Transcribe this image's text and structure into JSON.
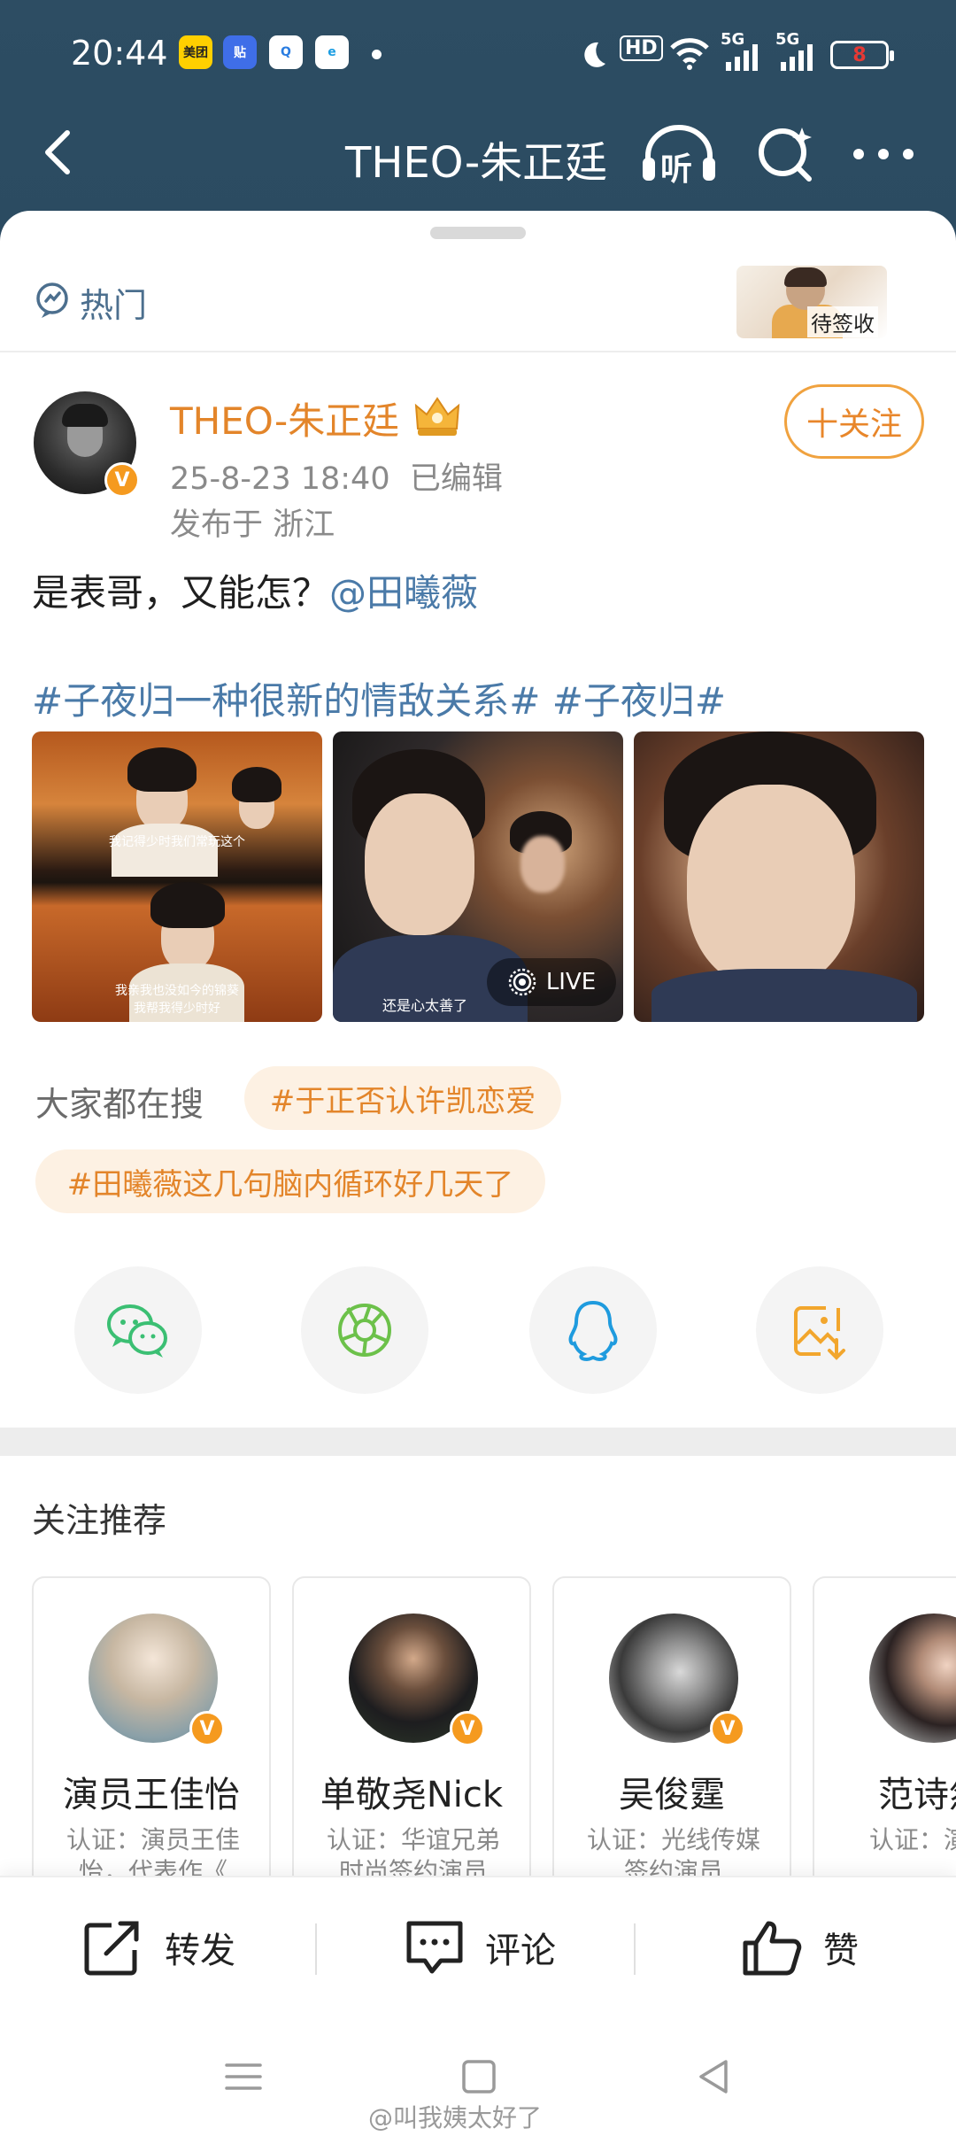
{
  "status_bar": {
    "time": "20:44",
    "app_icons": [
      {
        "name": "meituan-app-icon",
        "label": "美团",
        "bg": "#ffd000",
        "fg": "#222222"
      },
      {
        "name": "tieba-app-icon",
        "label": "贴",
        "bg": "#3f6ee8",
        "fg": "#ffffff"
      },
      {
        "name": "qq-browser-app-icon",
        "label": "Q",
        "bg": "#ffffff",
        "fg": "#2a7de1"
      },
      {
        "name": "edge-browser-app-icon",
        "label": "e",
        "bg": "#ffffff",
        "fg": "#1b9de2"
      }
    ],
    "hd_label": "HD",
    "signal_labels": [
      "5G",
      "5G"
    ],
    "battery": "8"
  },
  "nav": {
    "title": "THEO-朱正廷",
    "listen_label": "听"
  },
  "hot": {
    "label": "热门",
    "sticker_text": "待签收"
  },
  "post": {
    "username": "THEO-朱正廷",
    "verify_mark": "V",
    "timestamp": "25-8-23 18:40",
    "edited": "已编辑",
    "location": "发布于 浙江",
    "follow_label": "十关注",
    "text": "是表哥，又能怎？",
    "mention": "@田曦薇",
    "topics": "#子夜归一种很新的情敌关系# #子夜归#",
    "images": [
      {
        "captions": [
          "我记得少时我们常玩这个",
          "我亲我也没如今的锦葵",
          "我帮我得少时好"
        ]
      },
      {
        "captions": [
          "还是心太善了"
        ],
        "live_label": "LIVE"
      },
      {
        "captions": []
      }
    ]
  },
  "search": {
    "label": "大家都在搜",
    "tags": [
      "#于正否认许凯恋爱",
      "#田曦薇这几句脑内循环好几天了"
    ]
  },
  "share": [
    {
      "name": "wechat-share-button",
      "icon": "wechat-icon",
      "color": "#3bbf73"
    },
    {
      "name": "moments-share-button",
      "icon": "moments-icon",
      "color": "#6cc14a"
    },
    {
      "name": "qq-share-button",
      "icon": "qq-icon",
      "color": "#1f9bde"
    },
    {
      "name": "save-image-button",
      "icon": "save-image-icon",
      "color": "#f2a62d"
    }
  ],
  "recommend": {
    "title": "关注推荐",
    "cards": [
      {
        "name": "演员王佳怡",
        "desc": "认证：演员王佳怡，代表作《"
      },
      {
        "name": "单敬尧Nick",
        "desc": "认证：华谊兄弟时尚签约演员"
      },
      {
        "name": "吴俊霆",
        "desc": "认证：光线传媒签约演员"
      },
      {
        "name": "范诗然",
        "desc": "认证：演"
      }
    ]
  },
  "actions": {
    "repost": "转发",
    "comment": "评论",
    "like": "赞"
  },
  "watermark": "@叫我姨太好了",
  "colors": {
    "header_bg": "#2b4b61",
    "accent_orange": "#e3852a",
    "link_blue": "#4a7aa8"
  }
}
